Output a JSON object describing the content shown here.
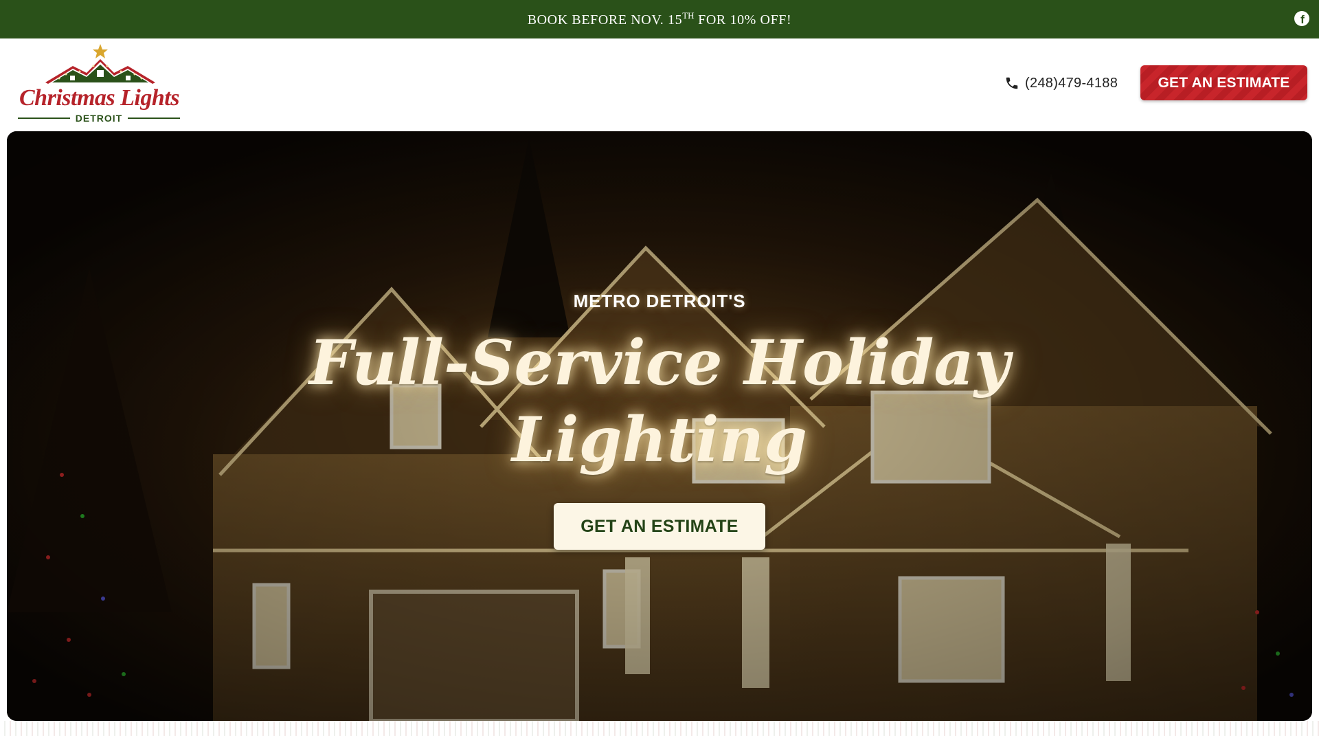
{
  "promo": {
    "text_before": "BOOK BEFORE NOV. 15",
    "superscript": "TH",
    "text_after": " FOR 10% OFF!",
    "social_icon": "facebook-icon"
  },
  "header": {
    "logo": {
      "script_text": "Christmas Lights",
      "city_text": "DETROIT"
    },
    "phone": {
      "icon": "phone-icon",
      "number": "(248)479-4188"
    },
    "cta_label": "GET AN ESTIMATE"
  },
  "hero": {
    "kicker": "METRO DETROIT'S",
    "title": "Full-Service Holiday Lighting",
    "cta_label": "GET AN ESTIMATE"
  },
  "colors": {
    "brand_green": "#2a5119",
    "brand_red": "#c8252b",
    "cream": "#fcf6e6"
  }
}
